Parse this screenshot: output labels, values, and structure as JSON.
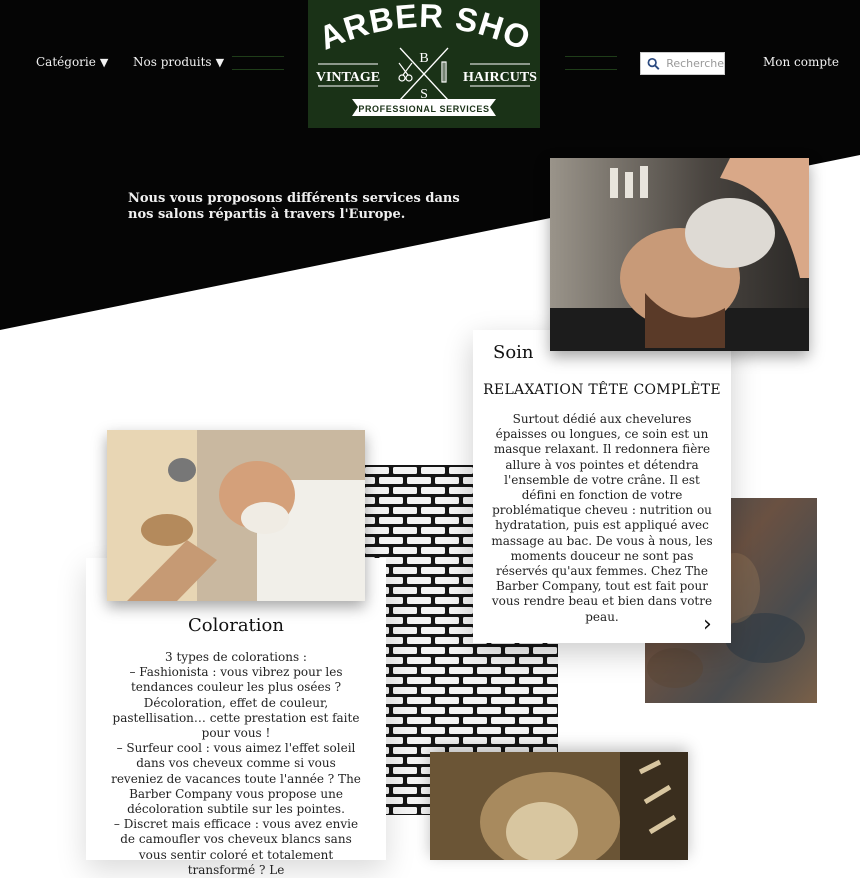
{
  "nav": {
    "categorie": "Catégorie",
    "produits": "Nos produits",
    "caret": "▼",
    "search_placeholder": "Recherche",
    "compte": "Mon compte"
  },
  "logo": {
    "top": "BARBER SHOP",
    "left": "VINTAGE",
    "right": "HAIRCUTS",
    "initial_1": "B",
    "initial_2": "S",
    "ribbon": "PROFESSIONAL SERVICES"
  },
  "intro": "Nous vous proposons différents services dans nos salons répartis à travers l'Europe.",
  "soin": {
    "category": "Soin",
    "title": "RELAXATION TÊTE COMPLÈTE",
    "text": "Surtout dédié aux chevelures épaisses ou longues, ce soin est un masque relaxant. Il redonnera fière allure à vos pointes et détendra l'ensemble de votre crâne. Il est défini en fonction de votre problématique cheveu : nutrition ou hydratation, puis est appliqué avec massage au bac. De vous à nous, les moments douceur ne sont pas réservés qu'aux femmes. Chez The Barber Company, tout est fait pour vous rendre beau et bien dans votre peau.",
    "arrow": "›"
  },
  "coloration": {
    "title": "Coloration",
    "text": "3 types de colorations :\n– Fashionista : vous vibrez pour les tendances couleur les plus osées ? Décoloration, effet de couleur, pastellisation… cette prestation est faite pour vous !\n– Surfeur cool : vous aimez l'effet soleil dans vos cheveux comme si vous reveniez de vacances toute l'année ? The Barber Company vous propose une décoloration subtile sur les pointes.\n– Discret mais efficace : vous avez envie de camoufler vos cheveux blancs sans vous sentir coloré et totalement transformé ? Le"
  },
  "colors": {
    "hero": "#050505",
    "logo_green": "#1a3217",
    "accent_line": "#1f3d19"
  }
}
